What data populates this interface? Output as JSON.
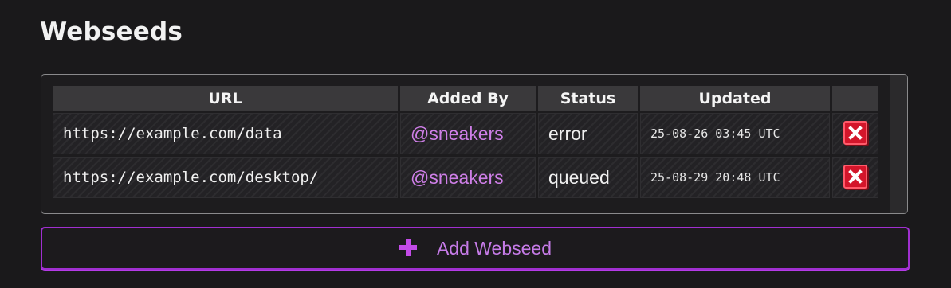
{
  "page": {
    "title": "Webseeds"
  },
  "table": {
    "columns": [
      "URL",
      "Added By",
      "Status",
      "Updated",
      ""
    ],
    "rows": [
      {
        "url": "https://example.com/data",
        "added_by": "@sneakers",
        "status": "error",
        "updated": "25-08-26 03:45 UTC"
      },
      {
        "url": "https://example.com/desktop/",
        "added_by": "@sneakers",
        "status": "queued",
        "updated": "25-08-29 20:48 UTC"
      }
    ]
  },
  "add_button": {
    "label": "Add Webseed",
    "icon": "plus-icon"
  },
  "row_action": {
    "icon": "close-icon"
  },
  "colors": {
    "accent": "#a02fd0",
    "link": "#cf7fe8",
    "danger": "#d3162b",
    "background": "#1a191b"
  }
}
